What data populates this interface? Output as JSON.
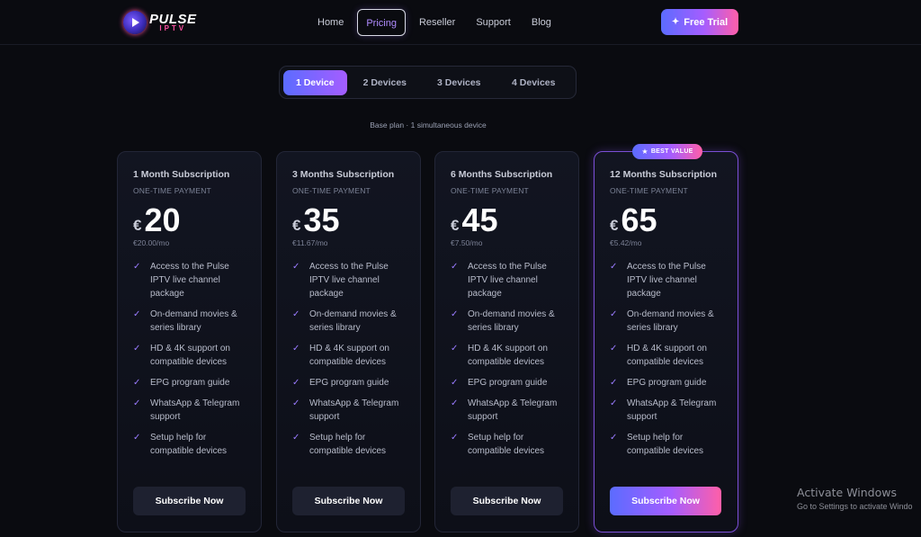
{
  "brand": {
    "name_line1": "PULSE",
    "name_line2": "IPTV",
    "logo_icon": "play-orb-icon"
  },
  "nav": {
    "items": [
      {
        "label": "Home",
        "active": false
      },
      {
        "label": "Pricing",
        "active": true
      },
      {
        "label": "Reseller",
        "active": false
      },
      {
        "label": "Support",
        "active": false
      },
      {
        "label": "Blog",
        "active": false
      }
    ],
    "cta_label": "Free Trial",
    "cta_icon": "sparkle-icon"
  },
  "device_tabs": [
    {
      "label": "1 Device",
      "active": true
    },
    {
      "label": "2 Devices",
      "active": false
    },
    {
      "label": "3 Devices",
      "active": false
    },
    {
      "label": "4 Devices",
      "active": false
    }
  ],
  "plan_note": "Base plan · 1 simultaneous device",
  "features": [
    "Access to the Pulse IPTV live channel package",
    "On-demand movies & series library",
    "HD & 4K support on compatible devices",
    "EPG program guide",
    "WhatsApp & Telegram support",
    "Setup help for compatible devices"
  ],
  "plans": [
    {
      "title": "1 Month Subscription",
      "subtitle": "ONE-TIME PAYMENT",
      "currency": "€",
      "price": "20",
      "per_month": "€20.00/mo",
      "button": "Subscribe Now",
      "featured": false
    },
    {
      "title": "3 Months Subscription",
      "subtitle": "ONE-TIME PAYMENT",
      "currency": "€",
      "price": "35",
      "per_month": "€11.67/mo",
      "button": "Subscribe Now",
      "featured": false
    },
    {
      "title": "6 Months Subscription",
      "subtitle": "ONE-TIME PAYMENT",
      "currency": "€",
      "price": "45",
      "per_month": "€7.50/mo",
      "button": "Subscribe Now",
      "featured": false
    },
    {
      "title": "12 Months Subscription",
      "subtitle": "ONE-TIME PAYMENT",
      "currency": "€",
      "price": "65",
      "per_month": "€5.42/mo",
      "button": "Subscribe Now",
      "featured": true,
      "badge": "BEST VALUE",
      "badge_icon": "star-icon"
    }
  ],
  "windows_watermark": {
    "title": "Activate Windows",
    "subtitle": "Go to Settings to activate Windo"
  },
  "colors": {
    "background": "#0a0b10",
    "accent_start": "#5b6cff",
    "accent_mid": "#a55dff",
    "accent_end": "#ff5fa8",
    "check": "#9a7bff"
  }
}
